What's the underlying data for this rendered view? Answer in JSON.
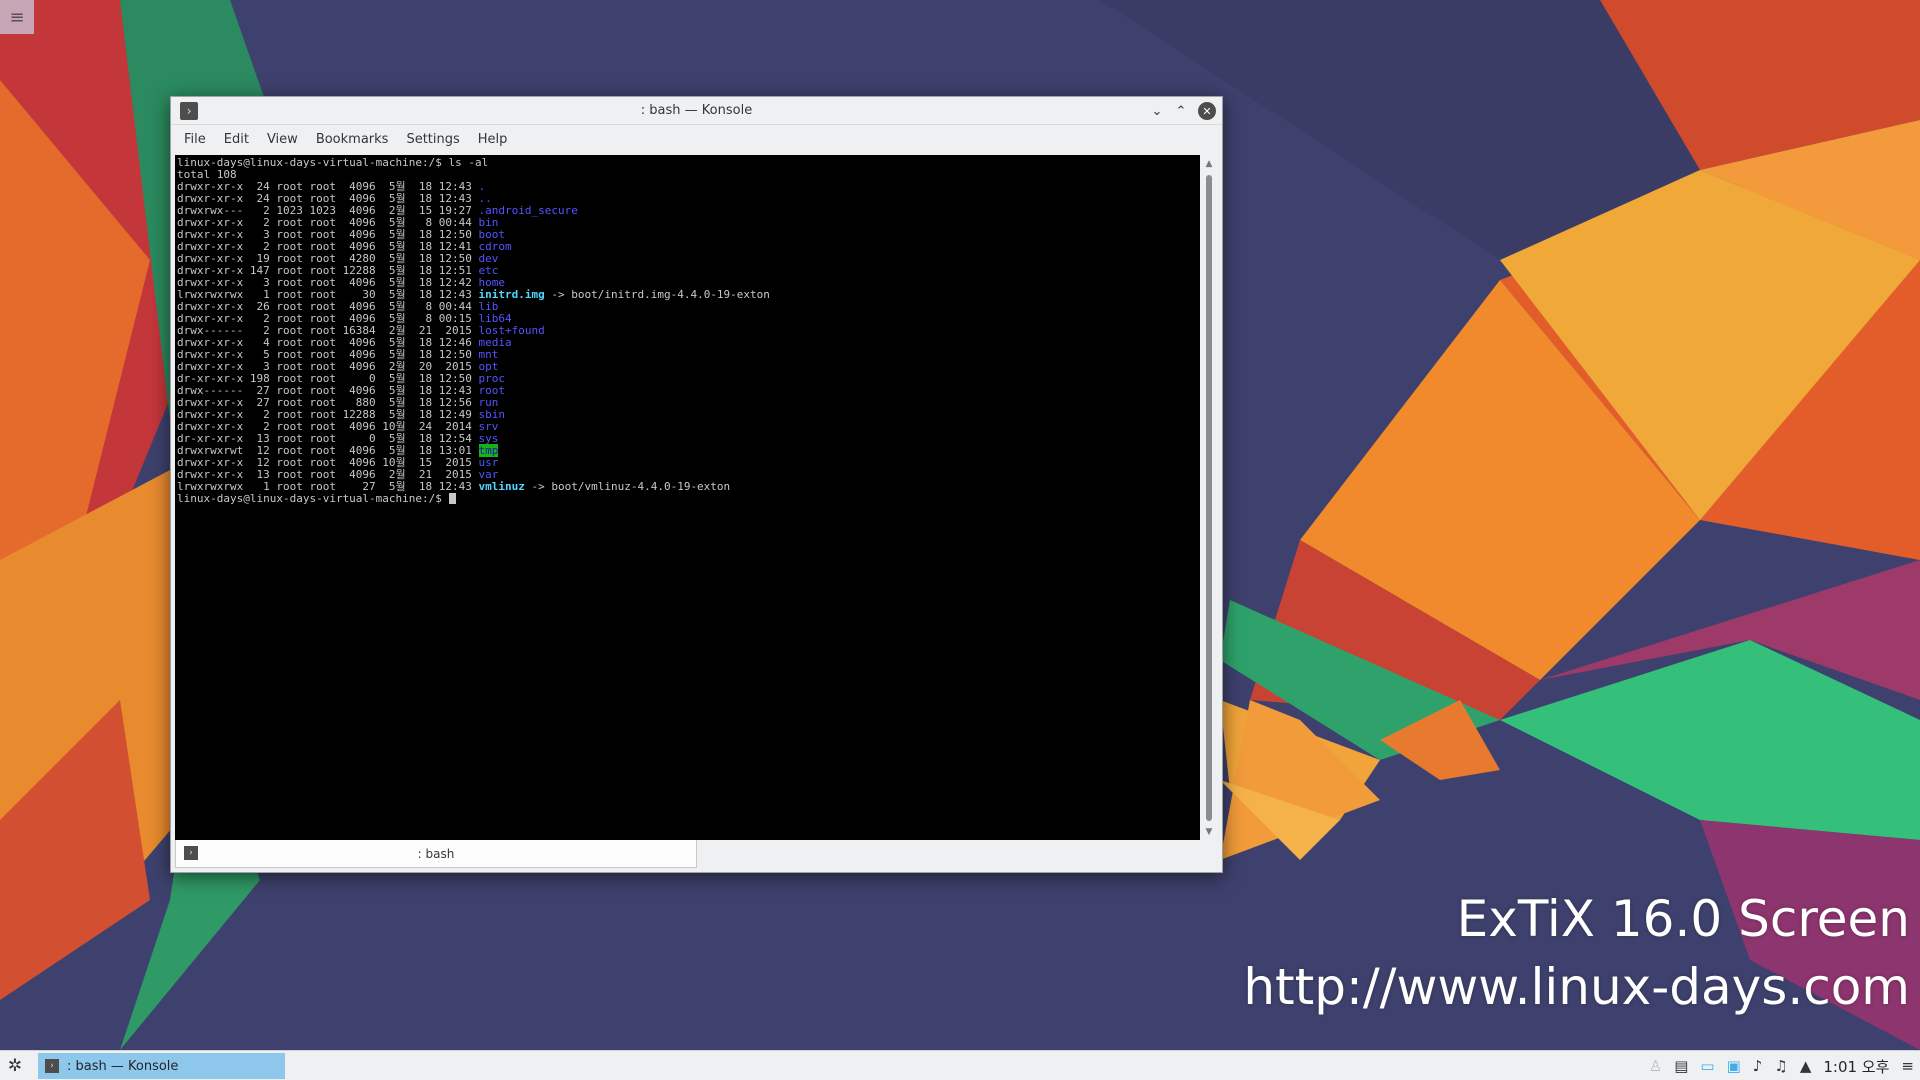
{
  "desktop": {
    "watermark_line1": "ExTiX 16.0 Screen",
    "watermark_line2": "http://www.linux-days.com"
  },
  "window": {
    "title": ": bash — Konsole",
    "menu": [
      "File",
      "Edit",
      "View",
      "Bookmarks",
      "Settings",
      "Help"
    ],
    "tab_label": ": bash"
  },
  "terminal": {
    "prompt": "linux-days@linux-days-virtual-machine:/$",
    "command": " ls -al",
    "total": "total 108",
    "entries": [
      {
        "meta": "drwxr-xr-x  24 root root  4096  5월  18 12:43 ",
        "name": ".",
        "style": "blue"
      },
      {
        "meta": "drwxr-xr-x  24 root root  4096  5월  18 12:43 ",
        "name": "..",
        "style": "blue"
      },
      {
        "meta": "drwxrwx---   2 1023 1023  4096  2월  15 19:27 ",
        "name": ".android_secure",
        "style": "blue"
      },
      {
        "meta": "drwxr-xr-x   2 root root  4096  5월   8 00:44 ",
        "name": "bin",
        "style": "blue"
      },
      {
        "meta": "drwxr-xr-x   3 root root  4096  5월  18 12:50 ",
        "name": "boot",
        "style": "blue"
      },
      {
        "meta": "drwxr-xr-x   2 root root  4096  5월  18 12:41 ",
        "name": "cdrom",
        "style": "blue"
      },
      {
        "meta": "drwxr-xr-x  19 root root  4280  5월  18 12:50 ",
        "name": "dev",
        "style": "blue"
      },
      {
        "meta": "drwxr-xr-x 147 root root 12288  5월  18 12:51 ",
        "name": "etc",
        "style": "blue"
      },
      {
        "meta": "drwxr-xr-x   3 root root  4096  5월  18 12:42 ",
        "name": "home",
        "style": "blue"
      },
      {
        "meta": "lrwxrwxrwx   1 root root    30  5월  18 12:43 ",
        "name": "initrd.img",
        "style": "cyan",
        "target": " -> boot/initrd.img-4.4.0-19-exton"
      },
      {
        "meta": "drwxr-xr-x  26 root root  4096  5월   8 00:44 ",
        "name": "lib",
        "style": "blue"
      },
      {
        "meta": "drwxr-xr-x   2 root root  4096  5월   8 00:15 ",
        "name": "lib64",
        "style": "blue"
      },
      {
        "meta": "drwx------   2 root root 16384  2월  21  2015 ",
        "name": "lost+found",
        "style": "blue"
      },
      {
        "meta": "drwxr-xr-x   4 root root  4096  5월  18 12:46 ",
        "name": "media",
        "style": "blue"
      },
      {
        "meta": "drwxr-xr-x   5 root root  4096  5월  18 12:50 ",
        "name": "mnt",
        "style": "blue"
      },
      {
        "meta": "drwxr-xr-x   3 root root  4096  2월  20  2015 ",
        "name": "opt",
        "style": "blue"
      },
      {
        "meta": "dr-xr-xr-x 198 root root     0  5월  18 12:50 ",
        "name": "proc",
        "style": "blue"
      },
      {
        "meta": "drwx------  27 root root  4096  5월  18 12:43 ",
        "name": "root",
        "style": "blue"
      },
      {
        "meta": "drwxr-xr-x  27 root root   880  5월  18 12:56 ",
        "name": "run",
        "style": "blue"
      },
      {
        "meta": "drwxr-xr-x   2 root root 12288  5월  18 12:49 ",
        "name": "sbin",
        "style": "blue"
      },
      {
        "meta": "drwxr-xr-x   2 root root  4096 10월  24  2014 ",
        "name": "srv",
        "style": "blue"
      },
      {
        "meta": "dr-xr-xr-x  13 root root     0  5월  18 12:54 ",
        "name": "sys",
        "style": "blue"
      },
      {
        "meta": "drwxrwxrwt  12 root root  4096  5월  18 13:01 ",
        "name": "tmp",
        "style": "tmpdir"
      },
      {
        "meta": "drwxr-xr-x  12 root root  4096 10월  15  2015 ",
        "name": "usr",
        "style": "blue"
      },
      {
        "meta": "drwxr-xr-x  13 root root  4096  2월  21  2015 ",
        "name": "var",
        "style": "blue"
      },
      {
        "meta": "lrwxrwxrwx   1 root root    27  5월  18 12:43 ",
        "name": "vmlinuz",
        "style": "cyan",
        "target": " -> boot/vmlinuz-4.4.0-19-exton"
      }
    ]
  },
  "taskbar": {
    "task_label": ": bash — Konsole",
    "clock": "1:01 오후",
    "tray_icons": [
      "user-switch-icon",
      "clipboard-icon",
      "notifications-icon",
      "network-icon",
      "volume-icon",
      "audio-icon",
      "expand-tray-icon",
      "panel-menu-icon"
    ]
  },
  "colors": {
    "terminal_bg": "#000000",
    "dir": "#5454ff",
    "symlink": "#54d6ff",
    "sticky_dir_bg": "#18b218",
    "taskbar_active": "#8ec7ec"
  }
}
